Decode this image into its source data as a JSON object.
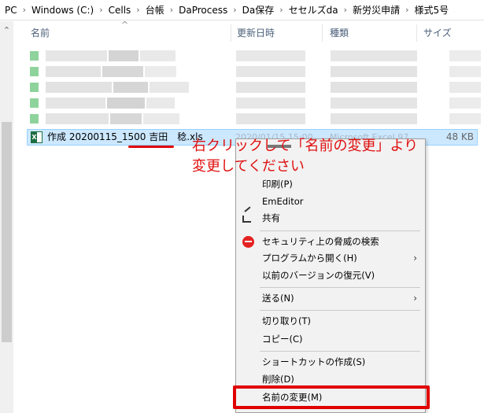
{
  "breadcrumb": [
    "PC",
    "Windows (C:)",
    "Cells",
    "台帳",
    "DaProcess",
    "Da保存",
    "セセルズda",
    "新労災申請",
    "様式5号"
  ],
  "columns": {
    "name": "名前",
    "modified": "更新日時",
    "type": "種類",
    "size": "サイズ"
  },
  "selected_file": {
    "name": "作成 20200115_1500 吉田　稔.xls",
    "date_ghost": "2020/01/15 15:00",
    "type_ghost": "Microsoft Excel 97",
    "size": "48 KB"
  },
  "annotation": {
    "line1": "右クリックして「名前の変更」より",
    "line2": "変更してください"
  },
  "context_menu": {
    "print": "印刷(P)",
    "emeditor": "EmEditor",
    "share": "共有",
    "security_scan": "セキュリティ上の脅威の検索",
    "open_with": "プログラムから開く(H)",
    "restore_versions": "以前のバージョンの復元(V)",
    "send_to": "送る(N)",
    "cut": "切り取り(T)",
    "copy": "コピー(C)",
    "create_shortcut": "ショートカットの作成(S)",
    "delete": "削除(D)",
    "rename": "名前の変更(M)"
  },
  "colors": {
    "selection_bg": "#cce8ff",
    "selection_border": "#99d1ff",
    "annotation_red": "#e01010",
    "menu_bg": "#f2f2f2"
  },
  "icons": {
    "xls": "excel-file-icon",
    "share": "share-icon",
    "security": "security-scan-icon"
  }
}
